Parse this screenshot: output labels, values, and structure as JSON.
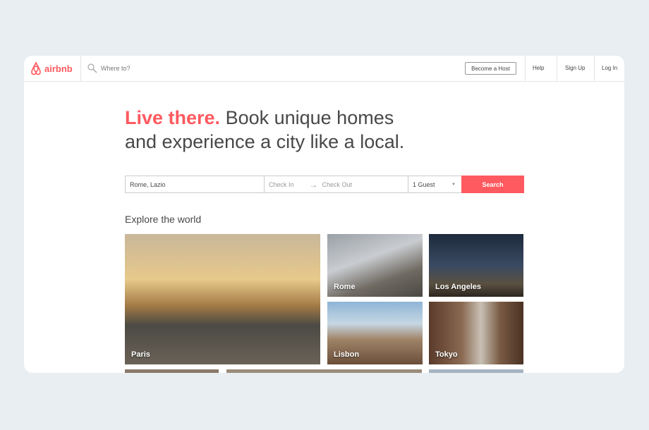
{
  "header": {
    "brand": "airbnb",
    "search_placeholder": "Where to?",
    "become_host": "Become a Host",
    "help": "Help",
    "sign_up": "Sign Up",
    "log_in": "Log In"
  },
  "hero": {
    "highlight": "Live there.",
    "rest": " Book unique homes",
    "line2": "and experience a city like a local."
  },
  "search": {
    "location": "Rome, Lazio",
    "check_in": "Check In",
    "check_out": "Check Out",
    "guests": "1 Guest",
    "button": "Search"
  },
  "explore": {
    "title": "Explore the world",
    "cities": [
      "Paris",
      "Rome",
      "Los Angeles",
      "Lisbon",
      "Tokyo"
    ]
  },
  "colors": {
    "brand": "#ff5a5f"
  }
}
